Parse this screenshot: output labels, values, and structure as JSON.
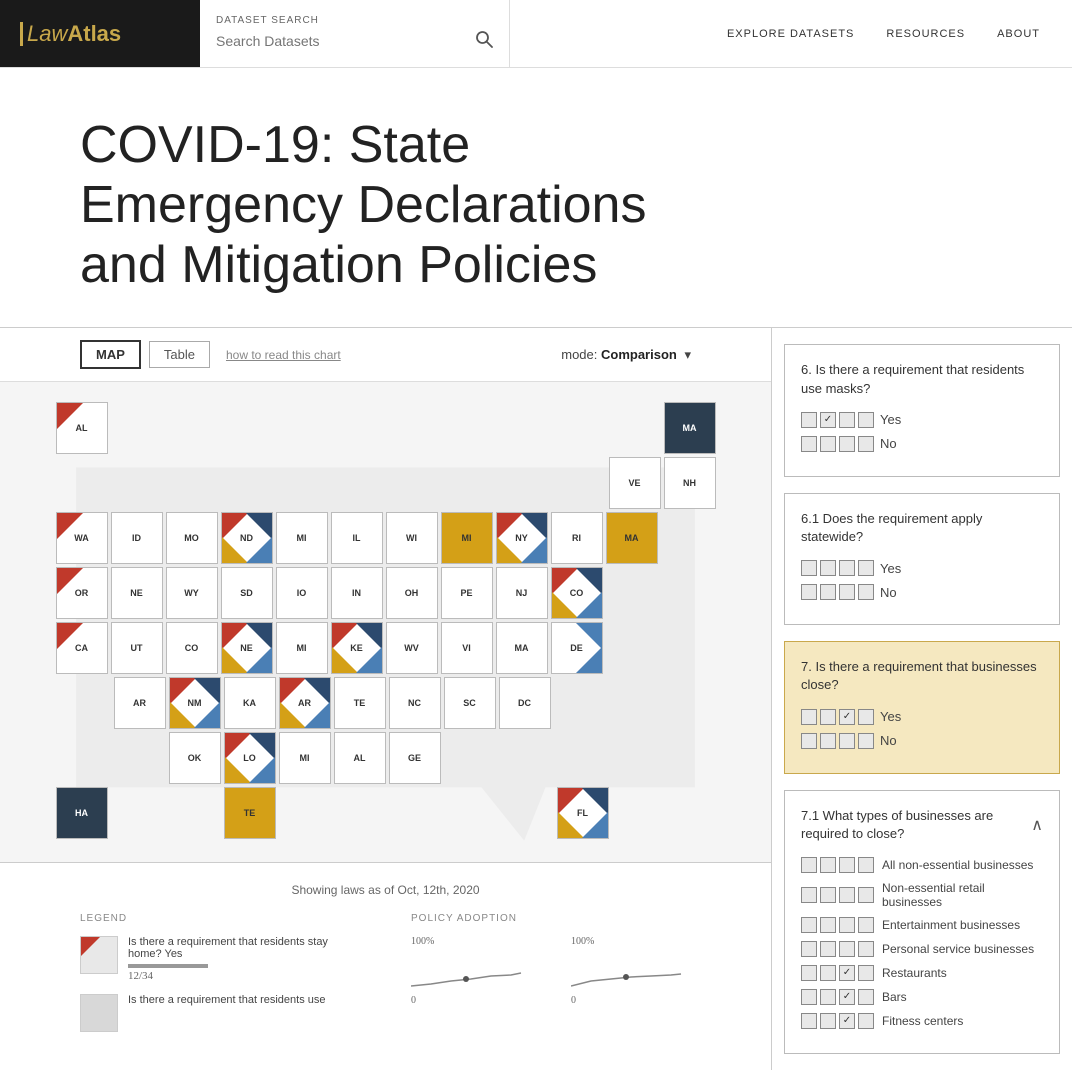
{
  "header": {
    "logo": "LawAtlas",
    "search_label": "DATASET SEARCH",
    "search_placeholder": "Search Datasets",
    "nav": [
      "EXPLORE DATASETS",
      "RESOURCES",
      "ABOUT"
    ]
  },
  "page": {
    "title": "COVID-19: State Emergency Declarations and Mitigation Policies"
  },
  "toolbar": {
    "map_btn": "MAP",
    "table_btn": "Table",
    "how_to": "how to read this chart",
    "mode_label": "mode:",
    "mode_value": "Comparison"
  },
  "map": {
    "showing_label": "Showing laws as of Oct, 12th, 2020"
  },
  "legend": {
    "title": "LEGEND",
    "items": [
      {
        "text": "Is there a requirement that residents stay home? Yes",
        "count": "12/34"
      },
      {
        "text": "Is there a requirement that residents use"
      }
    ]
  },
  "policy": {
    "title": "POLICY ADOPTION",
    "items": [
      {
        "percent": "100%",
        "zero": "0"
      },
      {
        "percent": "100%",
        "zero": "0"
      }
    ]
  },
  "sidebar": {
    "sections": [
      {
        "id": "q6",
        "question": "6. Is there a requirement that residents use masks?",
        "options": [
          {
            "label": "Yes",
            "checked": true,
            "index": 1
          },
          {
            "label": "No",
            "checked": false,
            "index": 1
          }
        ]
      },
      {
        "id": "q6_1",
        "question": "6.1 Does the requirement apply statewide?",
        "options": [
          {
            "label": "Yes",
            "checked": false,
            "index": 1
          },
          {
            "label": "No",
            "checked": false,
            "index": 1
          }
        ]
      },
      {
        "id": "q7",
        "question": "7. Is there a requirement that businesses close?",
        "highlighted": true,
        "options": [
          {
            "label": "Yes",
            "checked": true,
            "index": 2
          },
          {
            "label": "No",
            "checked": false,
            "index": 2
          }
        ]
      },
      {
        "id": "q7_1",
        "question": "7.1 What types of businesses are required to close?",
        "collapsible": true,
        "collapsed": false,
        "business_types": [
          {
            "label": "All non-essential businesses",
            "checked": false
          },
          {
            "label": "Non-essential retail businesses",
            "checked": false
          },
          {
            "label": "Entertainment businesses",
            "checked": false
          },
          {
            "label": "Personal service businesses",
            "checked": false
          },
          {
            "label": "Restaurants",
            "checked": false
          },
          {
            "label": "Bars",
            "checked": false
          },
          {
            "label": "Fitness centers",
            "checked": false
          }
        ]
      }
    ]
  },
  "states": {
    "rows": [
      [
        {
          "label": "AL",
          "col": 0,
          "pattern": "red-tl"
        },
        {
          "label": "MA",
          "col": 11,
          "pattern": "dark-all"
        }
      ],
      [
        {
          "label": "VE",
          "col": 10,
          "pattern": "none"
        },
        {
          "label": "NH",
          "col": 11,
          "pattern": "none"
        }
      ],
      [
        {
          "label": "WA",
          "col": 0,
          "pattern": "red-tl"
        },
        {
          "label": "ID",
          "col": 1,
          "pattern": "none"
        },
        {
          "label": "MO",
          "col": 2,
          "pattern": "none"
        },
        {
          "label": "ND",
          "col": 3,
          "pattern": "multi"
        },
        {
          "label": "MI",
          "col": 4,
          "pattern": "none"
        },
        {
          "label": "IL",
          "col": 5,
          "pattern": "none"
        },
        {
          "label": "WI",
          "col": 6,
          "pattern": "none"
        },
        {
          "label": "MI",
          "col": 7,
          "pattern": "yellow"
        },
        {
          "label": "NY",
          "col": 8,
          "pattern": "multi"
        },
        {
          "label": "RI",
          "col": 9,
          "pattern": "none"
        },
        {
          "label": "MA",
          "col": 10,
          "pattern": "yellow"
        }
      ],
      [
        {
          "label": "OR",
          "col": 0,
          "pattern": "red-tl"
        },
        {
          "label": "NE",
          "col": 1,
          "pattern": "none"
        },
        {
          "label": "WY",
          "col": 2,
          "pattern": "none"
        },
        {
          "label": "SD",
          "col": 3,
          "pattern": "none"
        },
        {
          "label": "IO",
          "col": 4,
          "pattern": "none"
        },
        {
          "label": "IN",
          "col": 5,
          "pattern": "none"
        },
        {
          "label": "OH",
          "col": 6,
          "pattern": "none"
        },
        {
          "label": "PE",
          "col": 7,
          "pattern": "none"
        },
        {
          "label": "NJ",
          "col": 8,
          "pattern": "none"
        },
        {
          "label": "CO",
          "col": 9,
          "pattern": "multi"
        }
      ],
      [
        {
          "label": "CA",
          "col": 0,
          "pattern": "red-tl"
        },
        {
          "label": "UT",
          "col": 1,
          "pattern": "none"
        },
        {
          "label": "CO",
          "col": 2,
          "pattern": "none"
        },
        {
          "label": "NE",
          "col": 3,
          "pattern": "multi"
        },
        {
          "label": "MI",
          "col": 4,
          "pattern": "none"
        },
        {
          "label": "KE",
          "col": 5,
          "pattern": "multi"
        },
        {
          "label": "WV",
          "col": 6,
          "pattern": "none"
        },
        {
          "label": "VI",
          "col": 7,
          "pattern": "none"
        },
        {
          "label": "MA",
          "col": 8,
          "pattern": "none"
        },
        {
          "label": "DE",
          "col": 9,
          "pattern": "blue-br"
        }
      ],
      [
        {
          "label": "AR",
          "col": 1,
          "pattern": "none"
        },
        {
          "label": "NM",
          "col": 2,
          "pattern": "multi"
        },
        {
          "label": "KA",
          "col": 3,
          "pattern": "none"
        },
        {
          "label": "AR",
          "col": 4,
          "pattern": "multi"
        },
        {
          "label": "TE",
          "col": 5,
          "pattern": "none"
        },
        {
          "label": "NC",
          "col": 6,
          "pattern": "none"
        },
        {
          "label": "SC",
          "col": 7,
          "pattern": "none"
        },
        {
          "label": "DC",
          "col": 8,
          "pattern": "none"
        }
      ],
      [
        {
          "label": "OK",
          "col": 2,
          "pattern": "none"
        },
        {
          "label": "LO",
          "col": 3,
          "pattern": "multi"
        },
        {
          "label": "MI",
          "col": 4,
          "pattern": "none"
        },
        {
          "label": "AL",
          "col": 5,
          "pattern": "none"
        },
        {
          "label": "GE",
          "col": 6,
          "pattern": "none"
        }
      ],
      [
        {
          "label": "HA",
          "col": 0,
          "pattern": "dark-all"
        },
        {
          "label": "TE",
          "col": 3,
          "pattern": "yellow"
        },
        {
          "label": "FL",
          "col": 9,
          "pattern": "multi"
        }
      ]
    ]
  }
}
